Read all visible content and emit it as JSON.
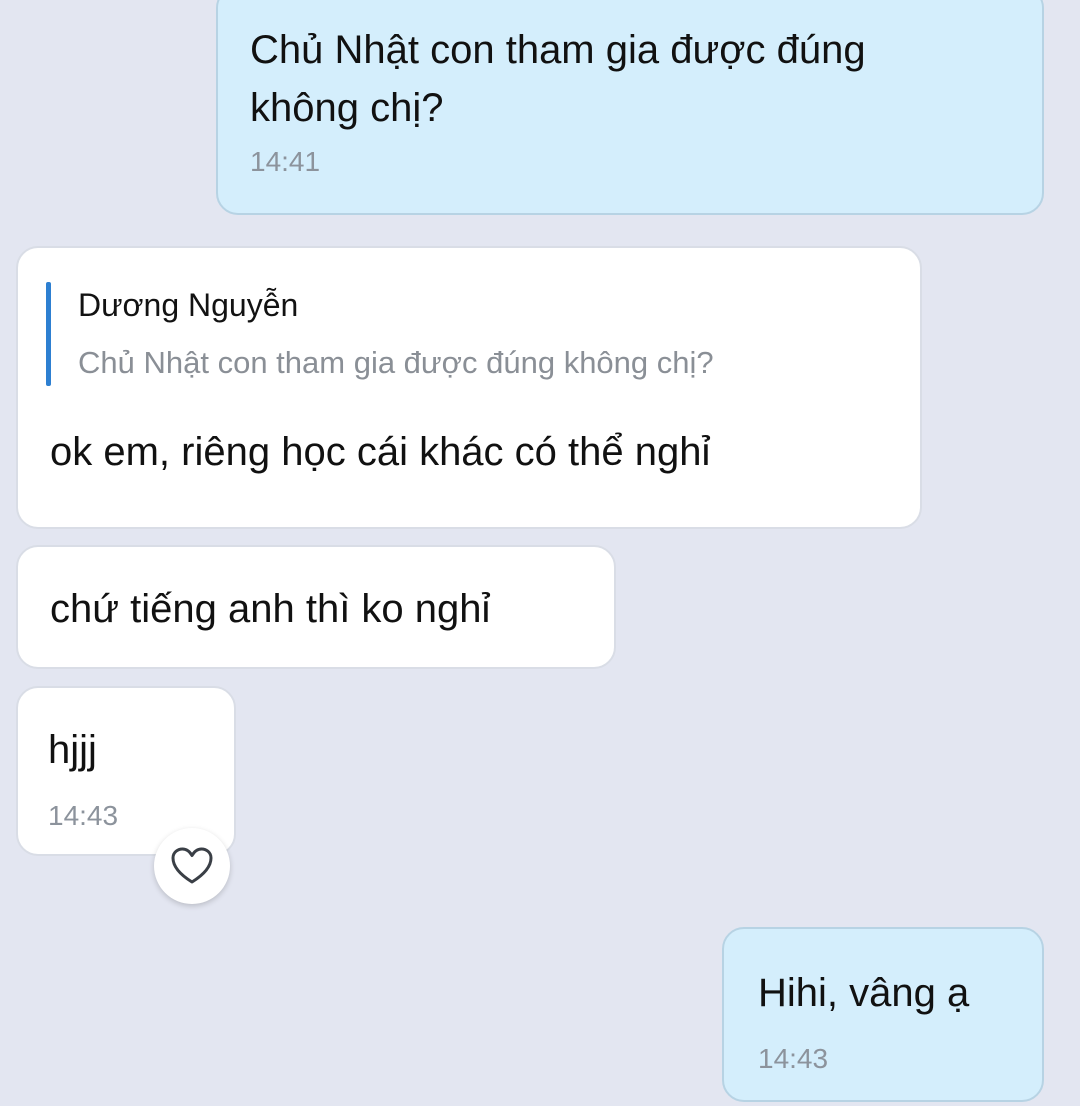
{
  "messages": [
    {
      "direction": "outgoing",
      "text_lines": [
        "Chủ Nhật con tham gia được đúng",
        "không chị?"
      ],
      "time": "14:41"
    },
    {
      "direction": "incoming",
      "reply_to": {
        "name": "Dương Nguyễn",
        "text": "Chủ Nhật con tham gia được đúng không chị?"
      },
      "text": "ok em, riêng học cái khác có thể nghỉ"
    },
    {
      "direction": "incoming",
      "text": "chứ tiếng anh thì ko nghỉ"
    },
    {
      "direction": "incoming",
      "text": "hjjj",
      "time": "14:43",
      "reaction_icon": "heart-outline-icon"
    },
    {
      "direction": "outgoing",
      "text": "Hihi, vâng ạ",
      "time": "14:43"
    }
  ],
  "colors": {
    "background": "#e3e6f1",
    "outgoing_bubble": "#d4eefc",
    "incoming_bubble": "#ffffff",
    "quote_accent": "#2d7fd1",
    "time_text": "#8c939c"
  }
}
